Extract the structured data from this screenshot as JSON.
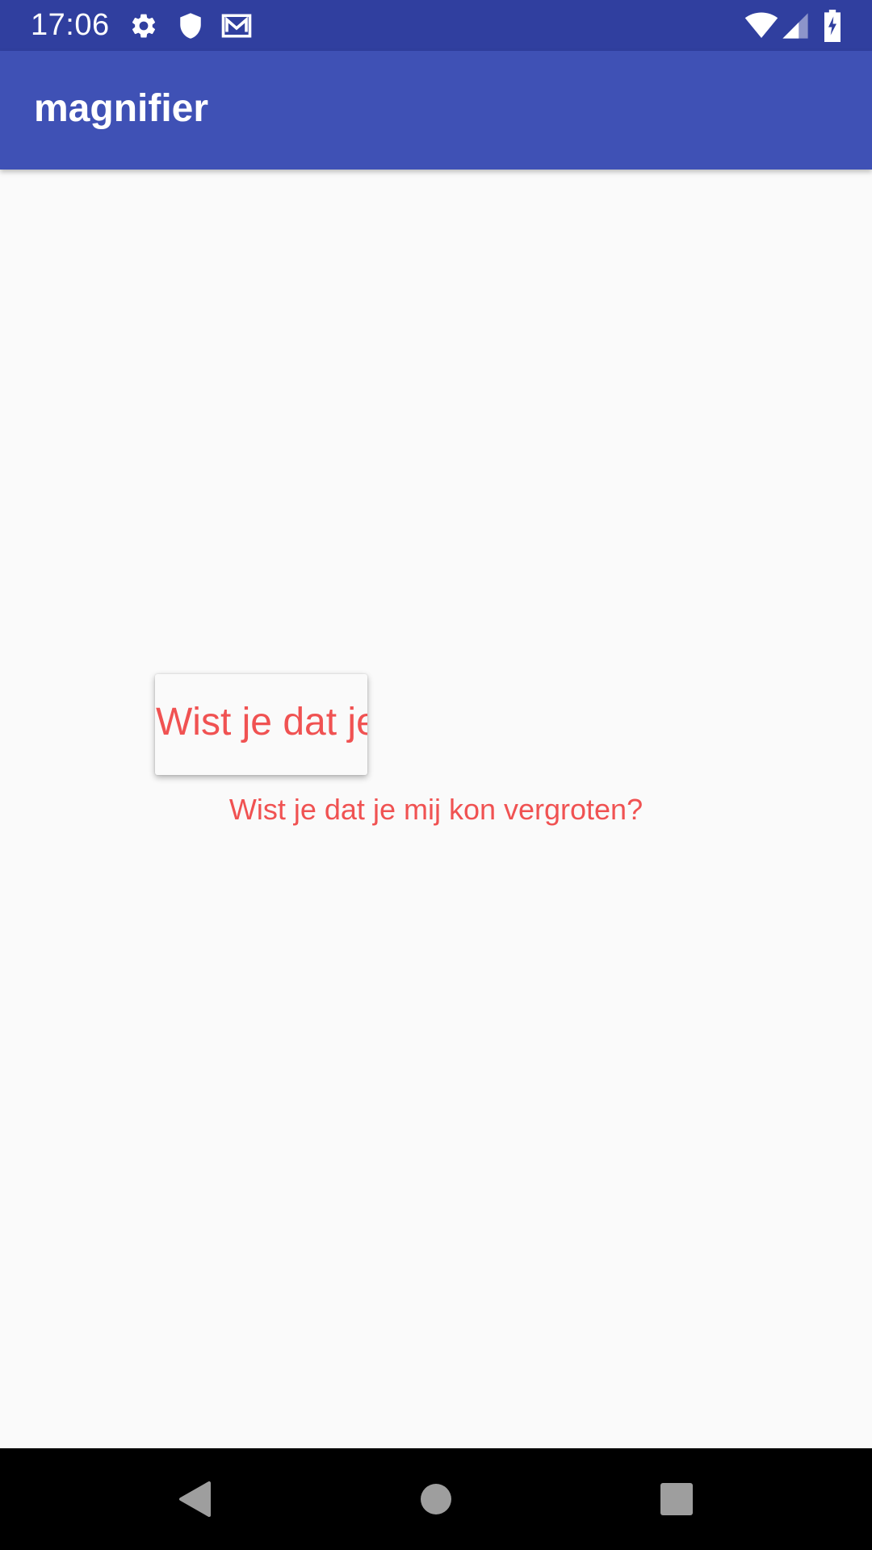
{
  "status_bar": {
    "time": "17:06",
    "icons_left": [
      "settings-icon",
      "shield-icon",
      "mail-icon"
    ],
    "icons_right": [
      "wifi-icon",
      "signal-icon",
      "battery-charging-icon"
    ],
    "background": "#303f9f"
  },
  "app_bar": {
    "title": "magnifier",
    "background": "#3f51b5"
  },
  "content": {
    "magnified_text": "Wist je dat je",
    "text": "Wist je dat je mij kon vergroten?",
    "text_color": "#f05252"
  },
  "nav_bar": {
    "buttons": [
      "back-icon",
      "home-icon",
      "recents-icon"
    ]
  }
}
